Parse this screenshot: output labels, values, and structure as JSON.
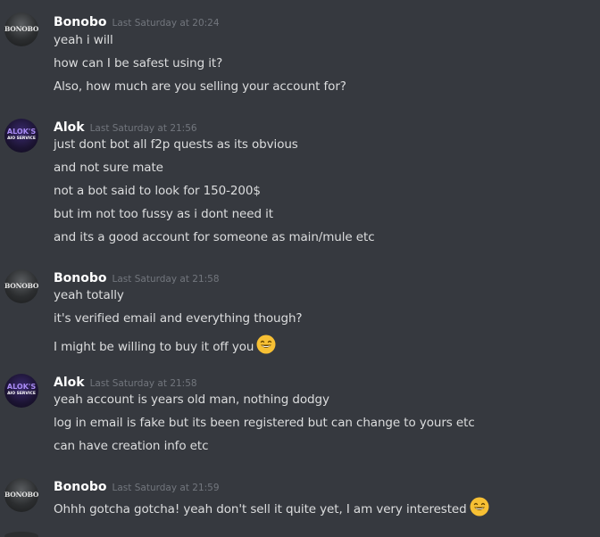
{
  "messages": [
    {
      "user": "Bonobo",
      "avatar_text": "BONOBO",
      "time": "Last Saturday at 20:24",
      "lines": [
        "yeah i will",
        "how can I be safest using it?",
        "Also, how much are you selling your account for?"
      ]
    },
    {
      "user": "Alok",
      "avatar_text": "ALOK'S",
      "avatar_sub": "AIO SERVICE",
      "time": "Last Saturday at 21:56",
      "lines": [
        "just dont bot all f2p quests as its obvious",
        "and not sure mate",
        "not a bot said to look for 150-200$",
        "but im not too fussy as i dont need it",
        "and its a good account for someone as main/mule etc"
      ]
    },
    {
      "user": "Bonobo",
      "avatar_text": "BONOBO",
      "time": "Last Saturday at 21:58",
      "lines": [
        "yeah totally",
        "it's verified email and everything though?",
        "I might be willing to buy it off you"
      ]
    },
    {
      "user": "Alok",
      "avatar_text": "ALOK'S",
      "avatar_sub": "AIO SERVICE",
      "time": "Last Saturday at 21:58",
      "lines": [
        "yeah account is years old man, nothing dodgy",
        "log in email is fake but its been registered but can change to yours etc",
        "can have creation info etc"
      ]
    },
    {
      "user": "Bonobo",
      "avatar_text": "BONOBO",
      "time": "Last Saturday at 21:59",
      "lines": [
        "Ohhh gotcha gotcha! yeah don't sell it quite yet, I am very interested"
      ]
    }
  ],
  "emoji": {
    "name": "smile-emoji",
    "color": "#f7c034"
  },
  "colors": {
    "background": "#36393f",
    "username": "#ffffff",
    "timestamp": "#72767d",
    "text": "#dcddde"
  }
}
